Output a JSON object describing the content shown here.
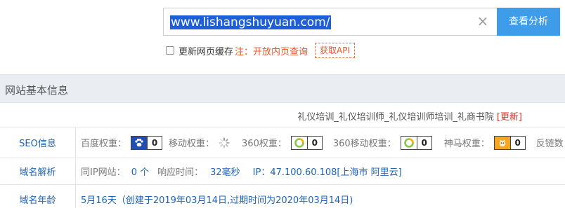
{
  "search": {
    "url_value": "www.lishangshuyuan.com/",
    "clear_glyph": "×",
    "submit_label": "查看分析"
  },
  "options": {
    "refresh_cache_label": "更新网页缓存",
    "note_text": "注：开放内页查询",
    "api_label": "获取API"
  },
  "section": {
    "title": "网站基本信息"
  },
  "site": {
    "title_text": "礼仪培训_礼仪培训师_礼仪培训师培训_礼商书院",
    "update_label": "[更新]"
  },
  "rows": {
    "seo": {
      "label": "SEO信息",
      "baidu_label": "百度权重：",
      "baidu_value": "0",
      "mobile_label": "移动权重：",
      "so360_label": "360权重：",
      "so360_value": "0",
      "so360_mobile_label": "360移动权重：",
      "so360_mobile_value": "0",
      "shenma_label": "神马权重：",
      "shenma_value": "0",
      "backlinks_label": "反链数："
    },
    "dns": {
      "label": "域名解析",
      "same_ip_label": "同IP网站：",
      "same_ip_value": "0 个",
      "response_label": "响应时间：",
      "response_value": "32毫秒",
      "ip_text": "IP：47.100.60.108[上海市 阿里云]"
    },
    "age": {
      "label": "域名年龄",
      "value": "5月16天（创建于2019年03月14日,过期时间为2020年03月14日)"
    }
  },
  "colors": {
    "accent": "#3f9ce8",
    "link": "#1f63b8",
    "warn": "#e8542a",
    "header_bg": "#eaeef3"
  }
}
